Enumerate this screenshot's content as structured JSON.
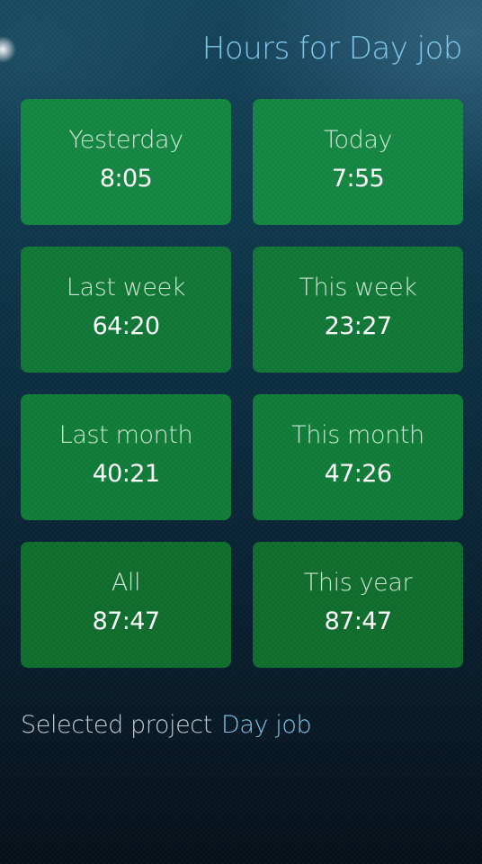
{
  "header": {
    "title": "Hours for Day job"
  },
  "tiles": [
    {
      "label": "Yesterday",
      "value": "8:05"
    },
    {
      "label": "Today",
      "value": "7:55"
    },
    {
      "label": "Last week",
      "value": "64:20"
    },
    {
      "label": "This week",
      "value": "23:27"
    },
    {
      "label": "Last month",
      "value": "40:21"
    },
    {
      "label": "This month",
      "value": "47:26"
    },
    {
      "label": "All",
      "value": "87:47"
    },
    {
      "label": "This year",
      "value": "87:47"
    }
  ],
  "footer": {
    "selected_label": "Selected project",
    "selected_value": "Day job"
  },
  "colors": {
    "accent": "#7fc6ea",
    "tile_green": "#12843f",
    "background_top": "#14445a",
    "background_bottom": "#050f18"
  }
}
